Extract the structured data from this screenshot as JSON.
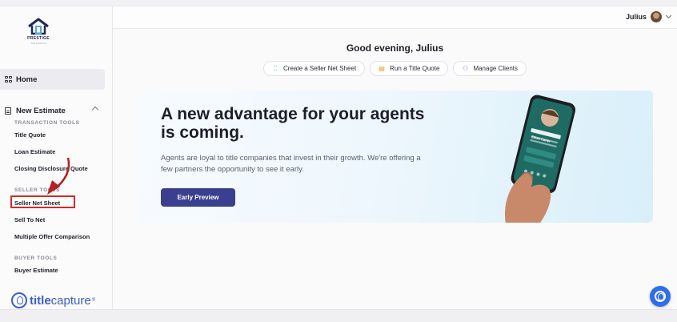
{
  "brand": {
    "name": "PRESTIGE",
    "tagline": "Title & Escrow",
    "footer_logo_bold": "title",
    "footer_logo_rest": "capture",
    "footer_logo_mark": "®",
    "accent": "#3a5ec7"
  },
  "sidebar": {
    "home": "Home",
    "new_estimate": "New Estimate",
    "sections": [
      {
        "title": "TRANSACTION TOOLS",
        "items": [
          "Title Quote",
          "Loan Estimate",
          "Closing Disclosure Quote"
        ]
      },
      {
        "title": "SELLER TOOLS",
        "items": [
          "Seller Net Sheet",
          "Sell To Net",
          "Multiple Offer Comparison"
        ]
      },
      {
        "title": "BUYER TOOLS",
        "items": [
          "Buyer Estimate"
        ]
      }
    ],
    "highlighted_item": "Seller Net Sheet",
    "highlight_color": "#d32a2a"
  },
  "header": {
    "user_name": "Julius"
  },
  "main": {
    "greeting": "Good evening, Julius",
    "actions": [
      {
        "label": "Create a Seller Net Sheet",
        "icon": "grid-icon",
        "color": "#2ca58d"
      },
      {
        "label": "Run a Title Quote",
        "icon": "document-icon",
        "color": "#e0a21c"
      },
      {
        "label": "Manage Clients",
        "icon": "users-icon",
        "color": "#6b8cd8"
      }
    ],
    "banner": {
      "headline": "A new advantage for your agents is coming.",
      "body": "Agents are loyal to title companies that invest in their growth. We're offering a few partners the opportunity to see it early.",
      "cta": "Early Preview",
      "phone_name": "Ethan Carter",
      "cta_color": "#3a3f8f"
    }
  },
  "help": {
    "icon": "help-chat-icon",
    "color": "#2f6ee8"
  }
}
